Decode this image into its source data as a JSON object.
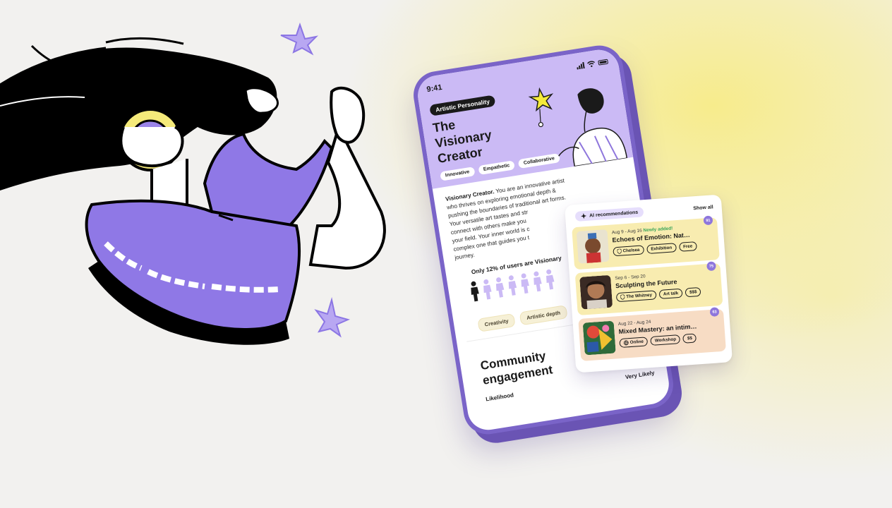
{
  "colors": {
    "accent_purple": "#8e76dc",
    "hero_lavender": "#cbbaf5",
    "card_yellow": "#f8ecb0",
    "card_peach": "#f7dcc4",
    "new_green": "#3aa55a"
  },
  "phone": {
    "status": {
      "time": "9:41"
    },
    "badge": "Artistic Personality",
    "title_lines": [
      "The",
      "Visionary",
      "Creator"
    ],
    "tags": [
      "Innovative",
      "Empathetic",
      "Collaborative"
    ],
    "description_lead": "Visionary Creator.",
    "description_lines": [
      " You are an innovative artist",
      "who thrives on exploring emotional depth &",
      "pushing the boundaries of traditional art forms.",
      "Your versatile art tastes and str",
      "connect with others make you",
      "your field. Your inner world is c",
      "complex one that guides you t",
      "journey."
    ],
    "stat_text": "Only 12% of users are Visionary",
    "traits": [
      "Creativity",
      "Artistic depth"
    ],
    "community_title_lines": [
      "Community",
      "engagement"
    ],
    "likelihood_label": "Likelihood",
    "likelihood_value": "Very Likely"
  },
  "recommendations": {
    "header_label": "AI recommendations",
    "show_all": "Show all",
    "events": [
      {
        "dates": "Aug 9 - Aug 16",
        "new_label": "Newly added!",
        "title": "Echoes of Emotion: Nat…",
        "tags": [
          "Chelsea",
          "Exhibition",
          "Free"
        ],
        "score": "91"
      },
      {
        "dates": "Sep 6 - Sep 20",
        "new_label": "",
        "title": "Sculpting the Future",
        "tags": [
          "The Whitney",
          "Art talk",
          "$$$"
        ],
        "score": "75"
      },
      {
        "dates": "Aug 22 - Aug 24",
        "new_label": "",
        "title": "Mixed Mastery: an intim…",
        "tags": [
          "Online",
          "Workshop",
          "$$"
        ],
        "score": "63"
      }
    ]
  }
}
